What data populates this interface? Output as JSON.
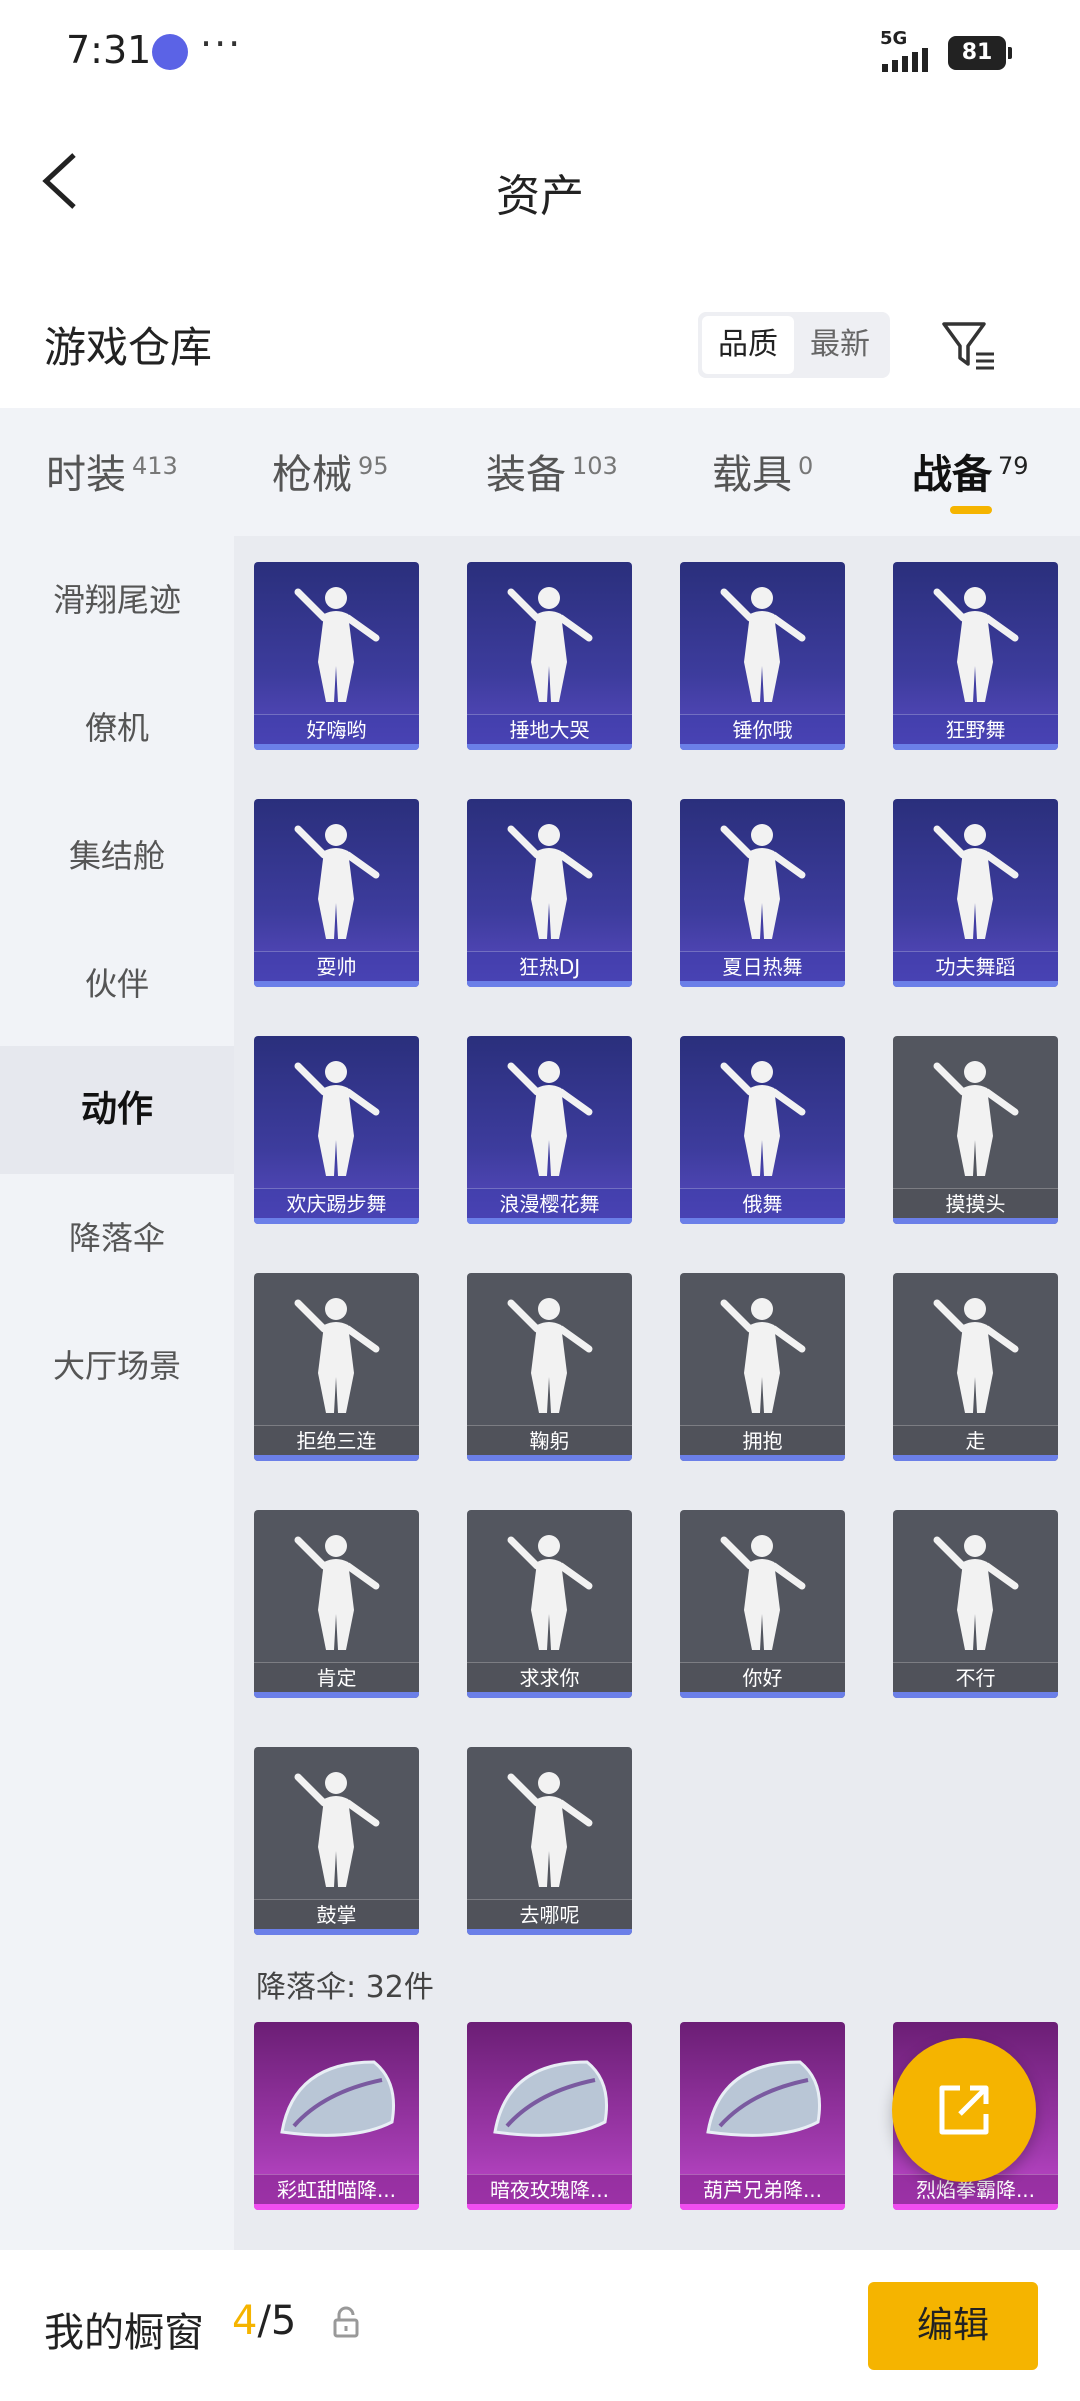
{
  "status_bar": {
    "time": "7:31",
    "network": "5G",
    "battery": "81"
  },
  "header": {
    "title": "资产"
  },
  "warehouse": {
    "title": "游戏仓库",
    "sort_options": [
      "品质",
      "最新"
    ],
    "active_sort": "品质"
  },
  "categories": [
    {
      "label": "时装",
      "count": "413"
    },
    {
      "label": "枪械",
      "count": "95"
    },
    {
      "label": "装备",
      "count": "103"
    },
    {
      "label": "载具",
      "count": "0"
    },
    {
      "label": "战备",
      "count": "79"
    }
  ],
  "active_category": "战备",
  "sidebar": {
    "items": [
      "滑翔尾迹",
      "僚机",
      "集结舱",
      "伙伴",
      "动作",
      "降落伞",
      "大厅场景"
    ],
    "active": "动作"
  },
  "actions": [
    {
      "name": "好嗨哟",
      "style": "purple"
    },
    {
      "name": "捶地大哭",
      "style": "purple"
    },
    {
      "name": "锤你哦",
      "style": "purple"
    },
    {
      "name": "狂野舞",
      "style": "purple"
    },
    {
      "name": "耍帅",
      "style": "purple"
    },
    {
      "name": "狂热DJ",
      "style": "purple"
    },
    {
      "name": "夏日热舞",
      "style": "purple"
    },
    {
      "name": "功夫舞蹈",
      "style": "purple"
    },
    {
      "name": "欢庆踢步舞",
      "style": "purple"
    },
    {
      "name": "浪漫樱花舞",
      "style": "purple"
    },
    {
      "name": "俄舞",
      "style": "purple"
    },
    {
      "name": "摸摸头",
      "style": "gray"
    },
    {
      "name": "拒绝三连",
      "style": "gray"
    },
    {
      "name": "鞠躬",
      "style": "gray"
    },
    {
      "name": "拥抱",
      "style": "gray"
    },
    {
      "name": "走",
      "style": "gray"
    },
    {
      "name": "肯定",
      "style": "gray"
    },
    {
      "name": "求求你",
      "style": "gray"
    },
    {
      "name": "你好",
      "style": "gray"
    },
    {
      "name": "不行",
      "style": "gray"
    },
    {
      "name": "鼓掌",
      "style": "gray"
    },
    {
      "name": "去哪呢",
      "style": "gray"
    }
  ],
  "parachute_section": {
    "label": "降落伞: 32件",
    "items": [
      "彩虹甜喵降...",
      "暗夜玫瑰降...",
      "葫芦兄弟降...",
      "烈焰拳霸降..."
    ]
  },
  "bottom_bar": {
    "label": "我的橱窗",
    "current": "4",
    "total": "/5",
    "edit_label": "编辑"
  },
  "icons": {
    "back": "chevron-left-icon",
    "filter": "filter-icon",
    "lock": "lock-icon",
    "share": "share-external-icon"
  },
  "colors": {
    "accent": "#f5b400",
    "card_purple": "#3d3c9d",
    "card_gray": "#53565f",
    "card_pink": "#a33bb0"
  }
}
